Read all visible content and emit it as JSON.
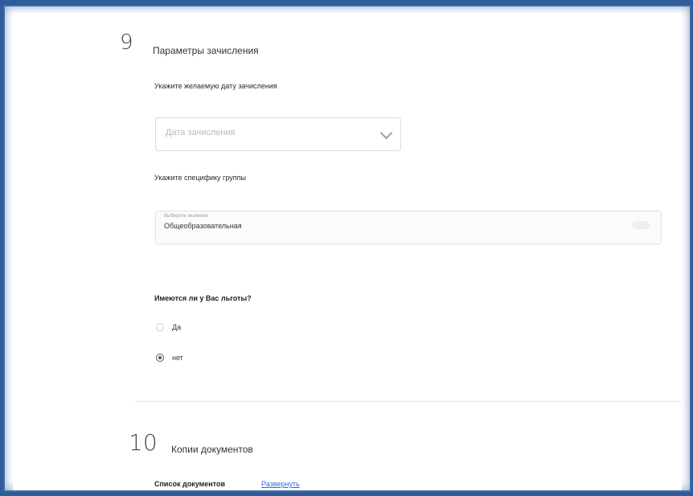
{
  "step9": {
    "number": "9",
    "title": "Параметры зачисления",
    "date_label": "Укажите желаемую дату зачисления",
    "date_placeholder": "Дата зачисления",
    "group_label": "Укажите специфику группы",
    "group_field_label": "Выберите значение",
    "group_value": "Общеобразовательная",
    "benefits_question": "Имеются ли у Вас льготы?",
    "options": [
      {
        "label": "Да",
        "checked": false
      },
      {
        "label": "нет",
        "checked": true
      }
    ]
  },
  "step10": {
    "number": "10",
    "title": "Копии документов",
    "docs_label": "Список документов",
    "expand_link": "Развернуть"
  }
}
